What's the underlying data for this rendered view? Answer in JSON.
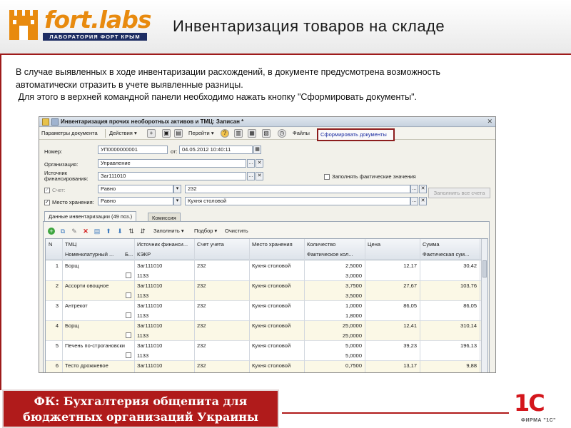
{
  "header": {
    "logo_text": "fort.labs",
    "logo_subtitle": "ЛАБОРАТОРИЯ ФОРТ КРЫМ",
    "title": "Инвентаризация товаров на складе"
  },
  "intro": {
    "line1": "В случае выявленных в ходе инвентаризации расхождений, в документе предусмотрена возможность",
    "line2": "автоматически отразить в учете выявленные разницы.",
    "line3": " Для этого в верхней командной панели необходимо нажать кнопку \"Сформировать документы\"."
  },
  "window": {
    "title": "Инвентаризация прочих необоротных активов и ТМЦ: Записан *",
    "cmd_params": "Параметры документа",
    "cmd_actions": "Действия",
    "cmd_goto": "Перейти",
    "cmd_files": "Файлы",
    "cmd_form_docs": "Сформировать документы",
    "form": {
      "number_label": "Номер:",
      "number_value": "УП0000000001",
      "date_label": "от:",
      "date_value": "04.05.2012 10:40:11",
      "org_label": "Организация:",
      "org_value": "Управление",
      "fin_label1": "Источник",
      "fin_label2": "финансирования:",
      "fin_value": "Заг111010",
      "fill_actual_label": "Заполнять фактические значения",
      "account_label": "Счет:",
      "account_cond": "Равно",
      "account_value": "232",
      "storage_label": "Место хранения:",
      "storage_cond": "Равно",
      "storage_value": "Кухня столовой",
      "fill_all_btn": "Заполнить все счета"
    },
    "tabs": {
      "data": "Данные инвентаризации (49 поз.)",
      "commission": "Комиссия"
    },
    "table_toolbar": {
      "fill": "Заполнить",
      "select": "Подбор",
      "clear": "Очистить"
    },
    "columns": {
      "n": "N",
      "tmc": "ТМЦ",
      "fin_source": "Источник финанси...",
      "account": "Счет учета",
      "storage": "Место хранения",
      "qty": "Количество",
      "price": "Цена",
      "sum": "Сумма",
      "nomen": "Номенклатурный ...",
      "b": "Б...",
      "kekv": "КЭКР",
      "actual_qty": "Фактическое кол...",
      "actual_sum": "Фактическая сум..."
    },
    "rows": [
      {
        "n": "1",
        "tmc": "Борщ",
        "fin": "Заг111010",
        "kekv": "1133",
        "account": "232",
        "storage": "Кухня столовой",
        "qty": "2,5000",
        "actual_qty": "3,0000",
        "price": "12,17",
        "sum": "30,42"
      },
      {
        "n": "2",
        "tmc": "Ассорти овощное",
        "fin": "Заг111010",
        "kekv": "1133",
        "account": "232",
        "storage": "Кухня столовой",
        "qty": "3,7500",
        "actual_qty": "3,5000",
        "price": "27,67",
        "sum": "103,76"
      },
      {
        "n": "3",
        "tmc": "Антрекот",
        "fin": "Заг111010",
        "kekv": "1133",
        "account": "232",
        "storage": "Кухня столовой",
        "qty": "1,0000",
        "actual_qty": "1,8000",
        "price": "86,05",
        "sum": "86,05"
      },
      {
        "n": "4",
        "tmc": "Борщ",
        "fin": "Заг111010",
        "kekv": "1133",
        "account": "232",
        "storage": "Кухня столовой",
        "qty": "25,0000",
        "actual_qty": "25,0000",
        "price": "12,41",
        "sum": "310,14"
      },
      {
        "n": "5",
        "tmc": "Печень по-строгановски",
        "fin": "Заг111010",
        "kekv": "1133",
        "account": "232",
        "storage": "Кухня столовой",
        "qty": "5,0000",
        "actual_qty": "5,0000",
        "price": "39,23",
        "sum": "196,13"
      },
      {
        "n": "6",
        "tmc": "Тесто дрожжевое",
        "fin": "Заг111010",
        "kekv": "1133",
        "account": "232",
        "storage": "Кухня столовой",
        "qty": "0,7500",
        "actual_qty": "0,7500",
        "price": "13,17",
        "sum": "9,88"
      }
    ]
  },
  "footer": {
    "line1": "ФК: Бухгалтерия общепита для",
    "line2": "бюджетных организаций Украины",
    "logo_big": "1С",
    "logo_small": "ФИРМА \"1С\""
  },
  "colors": {
    "accent_red": "#b01b1b",
    "logo_orange": "#e88a0e",
    "logo_navy": "#1d2d63"
  }
}
